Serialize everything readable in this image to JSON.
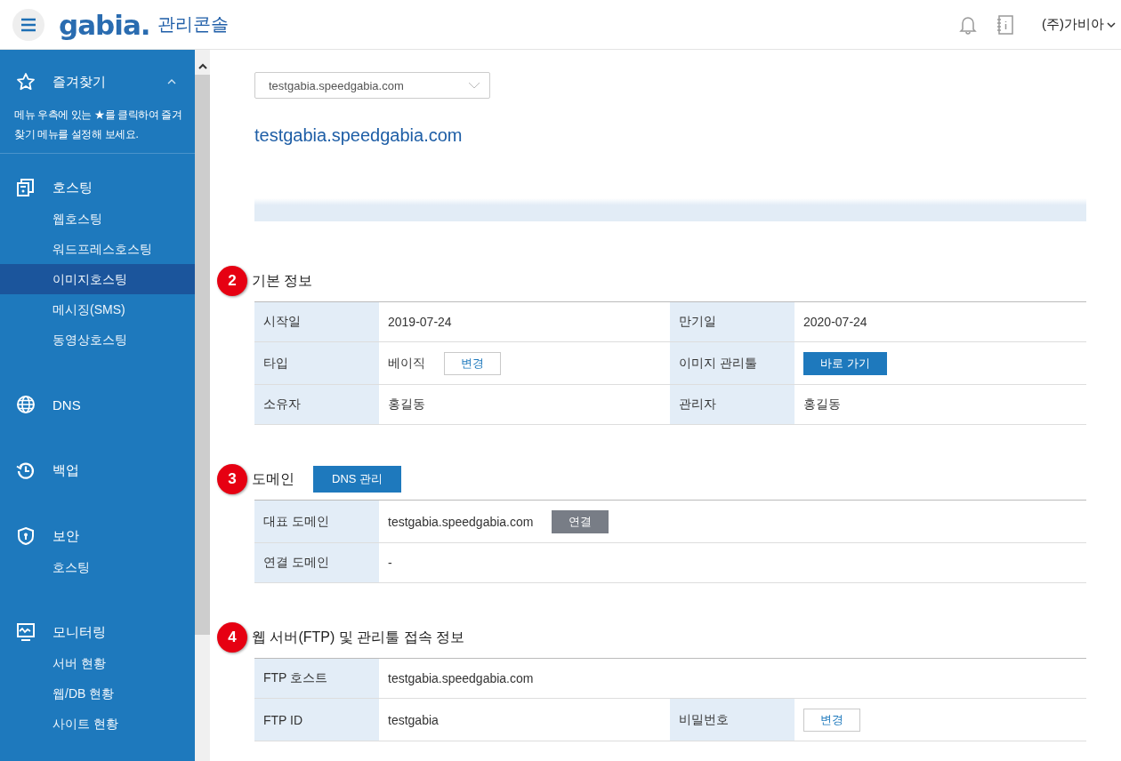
{
  "header": {
    "logo": "gabia.",
    "title": "관리콘솔",
    "account": "(주)가비아"
  },
  "sidebar": {
    "favorites": {
      "label": "즐겨찾기",
      "expanded": true,
      "hint": "메뉴 우측에 있는 ★를 클릭하여 즐겨찾기 메뉴를 설정해 보세요."
    },
    "groups": [
      {
        "label": "호스팅",
        "items": [
          {
            "label": "웹호스팅",
            "selected": false
          },
          {
            "label": "워드프레스호스팅",
            "selected": false
          },
          {
            "label": "이미지호스팅",
            "selected": true
          },
          {
            "label": "메시징(SMS)",
            "selected": false
          },
          {
            "label": "동영상호스팅",
            "selected": false
          }
        ]
      },
      {
        "label": "DNS"
      },
      {
        "label": "백업"
      },
      {
        "label": "보안",
        "items": [
          {
            "label": "호스팅",
            "selected": false
          }
        ]
      },
      {
        "label": "모니터링",
        "items": [
          {
            "label": "서버 현황",
            "selected": false
          },
          {
            "label": "웹/DB 현황",
            "selected": false
          },
          {
            "label": "사이트 현황",
            "selected": false
          }
        ]
      }
    ]
  },
  "service_select": {
    "value": "testgabia.speedgabia.com"
  },
  "page_title": "testgabia.speedgabia.com",
  "sections": [
    {
      "number": "2",
      "title": "기본 정보",
      "rows": [
        [
          {
            "kind": "label",
            "text": "시작일"
          },
          {
            "kind": "value",
            "text": "2019-07-24"
          },
          {
            "kind": "label",
            "text": "만기일"
          },
          {
            "kind": "value",
            "text": "2020-07-24"
          }
        ],
        [
          {
            "kind": "label",
            "text": "타입"
          },
          {
            "kind": "value",
            "text": "베이직",
            "button": {
              "label": "변경",
              "kind": "secondary"
            }
          },
          {
            "kind": "label",
            "text": "이미지 관리툴"
          },
          {
            "kind": "value",
            "button": {
              "label": "바로 가기",
              "kind": "primary"
            }
          }
        ],
        [
          {
            "kind": "label",
            "text": "소유자"
          },
          {
            "kind": "value",
            "text": "홍길동"
          },
          {
            "kind": "label",
            "text": "관리자"
          },
          {
            "kind": "value",
            "text": "홍길동"
          }
        ]
      ]
    },
    {
      "number": "3",
      "title": "도메인",
      "button": "DNS 관리",
      "rows": [
        [
          {
            "kind": "label",
            "text": "대표 도메인"
          },
          {
            "kind": "value",
            "text": "testgabia.speedgabia.com",
            "button": {
              "label": "연결",
              "kind": "neutral"
            }
          }
        ],
        [
          {
            "kind": "label",
            "text": "연결 도메인"
          },
          {
            "kind": "value",
            "text": "-"
          }
        ]
      ]
    },
    {
      "number": "4",
      "title": "웹 서버(FTP) 및 관리툴 접속 정보",
      "rows": [
        [
          {
            "kind": "label",
            "text": "FTP 호스트"
          },
          {
            "kind": "value",
            "text": "testgabia.speedgabia.com"
          }
        ],
        [
          {
            "kind": "label",
            "text": "FTP ID"
          },
          {
            "kind": "value",
            "text": "testgabia"
          },
          {
            "kind": "label",
            "text": "비밀번호"
          },
          {
            "kind": "value",
            "button": {
              "label": "변경",
              "kind": "secondary"
            }
          }
        ]
      ]
    }
  ]
}
